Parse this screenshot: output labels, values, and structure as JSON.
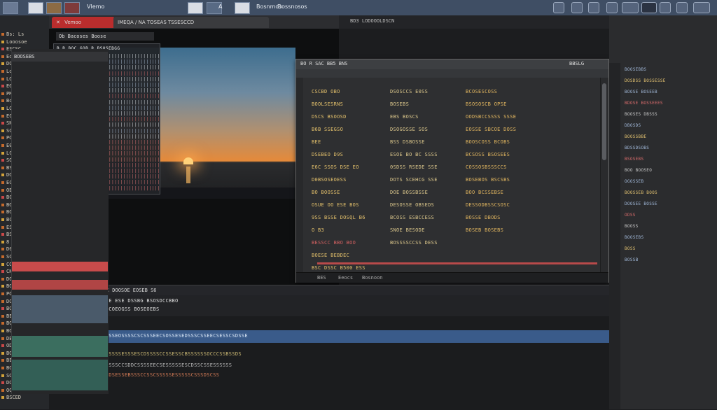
{
  "taskbar": {
    "left_text": "Vlemo",
    "center_text_1": "A",
    "center_text_2": "Bosnmos",
    "center_text_3": "Dossnosos"
  },
  "browser": {
    "active_tab": "Vemoo",
    "tab2": "IMEQA  /  NA  TOSEAS  TSSESCCD",
    "address_bar": "Ob  Bacoses  Boose",
    "right_top": "BD3  LODOOOLDSCN"
  },
  "sidebar": {
    "items": [
      "Bs: Ls",
      "Looosoe",
      "ESCSC",
      "Eoone",
      "DOODCH S0",
      "Lonsass BS",
      "LO00 DE0Ba",
      "EGB B0SECE",
      "PMSOF",
      "Boaeos",
      "LOS EC EA",
      "ECEDCOSS",
      "SN.B 38",
      "SCED",
      "POO0COSSE",
      "E0 0BD",
      "LCCE DOBB",
      "SOSB",
      "BSCDRSDS",
      "DODCKSNDS",
      "ECOE COE",
      "OBSIDES",
      "BCB0CSNS",
      "BOB E ESB",
      "BOE DCOCCE",
      "BCEBCBDC E",
      "ESC",
      "BSOCC",
      "8 BSS DES",
      "D0SSBCSS",
      "SCCSC",
      "CODOSEASB",
      "CN BOR",
      "DOLQESS",
      "BOCSEBS",
      "POCOSEOS",
      "DOE SEE",
      "BOOSSE",
      "BEOSSBDS",
      "BOSEBS",
      "BOOBSEES",
      "DB COSSBE",
      "ODEBODS",
      "BOOSS",
      "BECOS",
      "BOOLES",
      "SOOS BSS",
      "DOSSOSBE",
      "OOSSDS",
      "BSCED"
    ]
  },
  "viewer": {
    "code_overlay_header": "B  R  BOC  GOB   R  BSOSEBGG",
    "code_rows": 24
  },
  "editor": {
    "title": "BO  R  SAC    BB5  BNS",
    "tab_right": "BBSLG",
    "status_left": "BES",
    "status_center": "Eeocs",
    "status_right": "Bosnoon",
    "col1": [
      "CSCBD  OBO",
      "BOOLSESRNS",
      "DSCS  BSOOSD",
      "B6B  SSEGSO",
      "BEE",
      "DSEBEO  D9S",
      "E6C  SSOS  DSE  EO",
      "D0BSOSEOESS",
      "BO  BOOSSE",
      "OSUE  OO  ESE  BOS",
      "9SS  BSSE  DOSQL  B6",
      "O  B3",
      "BESSCC  BBO  BOO",
      "BOESE  BEBDEC",
      "BSC  DSSC  B500  ESS"
    ],
    "col2": [
      "DSOSCCS  E0SS",
      "BOSEBS",
      "EBS  BOSCS",
      "DSOGOSSE  SOS",
      "BSS  DSBOSSE",
      "ESOE  BO  BC  SSSS",
      "0SDSS  RSEDE  SSE",
      "DOTS  SCEHCG  SSE",
      "DOE  BOSSBSSE",
      "DESOSSE  OBSEDS",
      "BCOSS  ESBCCESS",
      "SNOE  BESODE",
      "BOSSSSCCSS  DESS"
    ],
    "col3": [
      "BCOSESCOSS",
      "BSOSOSCB  OPSE",
      "OODSBCCSSSS  SSSE",
      "EOSSE  SBCOE  DOSS",
      "BOOSCOSS  BCOBS",
      "BCSOSS  BSOSEES",
      "COSSOSBSSSCCS",
      "BOSEBOS  BSCSBS",
      "BOO  BCSSEBSE",
      "DESSODBSSCSOSC",
      "BOSSE  DBODS",
      "BOSEB  BOSEBS"
    ]
  },
  "console": {
    "header": "BOSDS  ESCC  B  BOSE  E  DOOSOE  EOSEB  S6",
    "row1": "DBSSECS  ESOS  BSCOEE  ESE  DSSBG  BSOSDCCBBO",
    "row2": "ESSESCBO  BOSOBG  ESCOEOGSS  BOSEOEBS",
    "row3": "BOSESOOS  BOSSCSOSBSSEOSSSSCSCSSSEECSOSSESEDSSSCSSEECSESSCSDSSE",
    "row4": "BSSDSE  SECSDSESSSCSSSSESSSESCDSSSSCCSSESSCBSSSSSSOCCCSSBSSDS",
    "row5": "SESSS  SSCBSCSBSSCBSSSCCSDDCSSSSEECSESSSSSESCDSSCSSESSSSSS",
    "row6": "DEOSSSCSS  BCOSSSCCDSESSEBSSSCCSSCSSSSSESSSSSCSSSDSCSS"
  },
  "rightpanel": {
    "header": "BOOSEBS",
    "rows": [
      "BOOSEBBS",
      "DOSDSS  BOSSESSE",
      "BOOSE  BOSEEB",
      "BDOSE  BOSSEEES",
      "BOOSES  DBSSS",
      "DBOSDS",
      "BOOSSBBE",
      "BDSSDSOBS",
      "BSOSEBS",
      "BOO  BOOSEO",
      "OGOSSEB",
      "BOOSSEB  BOOS",
      "DOOSEE  BOSSE",
      "ODSS",
      "BOOSS",
      "BOOSEBS",
      "BOSS",
      "BOSSB"
    ]
  },
  "colors": {
    "accent_red": "#ba2d2d",
    "selection_blue": "#3a5b8a",
    "code_orange": "#d69a3a",
    "code_yellow": "#cfc37a",
    "code_red": "#d0585a",
    "code_blue": "#7ea7d8"
  }
}
